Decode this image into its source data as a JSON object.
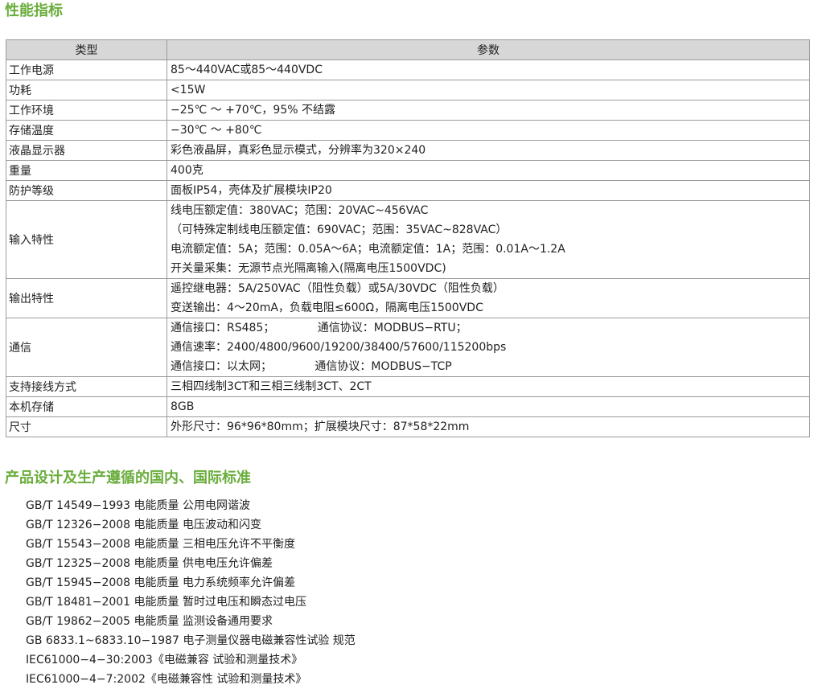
{
  "section1_title": "性能指标",
  "table": {
    "headers": [
      "类型",
      "参数"
    ],
    "rows": [
      {
        "type": "工作电源",
        "lines": [
          "85～440VAC或85～440VDC"
        ]
      },
      {
        "type": "功耗",
        "lines": [
          "<15W"
        ]
      },
      {
        "type": "工作环境",
        "lines": [
          "−25℃ ～ +70℃，95% 不结露"
        ]
      },
      {
        "type": "存储温度",
        "lines": [
          "−30℃ ～ +80℃"
        ]
      },
      {
        "type": "液晶显示器",
        "lines": [
          "彩色液晶屏，真彩色显示模式，分辨率为320×240"
        ]
      },
      {
        "type": "重量",
        "lines": [
          "400克"
        ]
      },
      {
        "type": "防护等级",
        "lines": [
          "面板IP54，壳体及扩展模块IP20"
        ]
      },
      {
        "type": "输入特性",
        "lines": [
          "线电压额定值：380VAC；范围：20VAC~456VAC",
          "（可特殊定制线电压额定值：690VAC；范围：35VAC~828VAC）",
          "电流额定值：5A；范围：0.05A～6A；电流额定值：1A；范围：0.01A～1.2A",
          "开关量采集：无源节点光隔离输入(隔离电压1500VDC)"
        ]
      },
      {
        "type": "输出特性",
        "lines": [
          "遥控继电器：5A/250VAC（阻性负载）或5A/30VDC（阻性负载）",
          "变送输出：4～20mA，负载电阻≤600Ω，隔离电压1500VDC"
        ]
      },
      {
        "type": "通信",
        "lines": [
          "通信接口：RS485；            通信协议：MODBUS−RTU；",
          "通信速率：2400/4800/9600/19200/38400/57600/115200bps",
          "通信接口：以太网；            通信协议：MODBUS−TCP"
        ]
      },
      {
        "type": "支持接线方式",
        "lines": [
          "三相四线制3CT和三相三线制3CT、2CT"
        ]
      },
      {
        "type": "本机存储",
        "lines": [
          "8GB"
        ]
      },
      {
        "type": "尺寸",
        "lines": [
          "外形尺寸：96*96*80mm；扩展模块尺寸：87*58*22mm"
        ]
      }
    ]
  },
  "section2_title": "产品设计及生产遵循的国内、国际标准",
  "standards": [
    "GB/T 14549−1993 电能质量 公用电网谐波",
    "GB/T 12326−2008 电能质量 电压波动和闪变",
    "GB/T 15543−2008 电能质量 三相电压允许不平衡度",
    "GB/T 12325−2008 电能质量 供电电压允许偏差",
    "GB/T 15945−2008 电能质量 电力系统频率允许偏差",
    "GB/T 18481−2001 电能质量 暂时过电压和瞬态过电压",
    "GB/T 19862−2005 电能质量 监测设备通用要求",
    "GB 6833.1~6833.10−1987 电子测量仪器电磁兼容性试验 规范",
    "IEC61000−4−30:2003《电磁兼容 试验和测量技术》",
    "IEC61000−4−7:2002《电磁兼容性 试验和测量技术》"
  ],
  "colors": {
    "accent": "#6aad3c",
    "header_bg": "#d7d7d7",
    "border": "#9a9a9a"
  }
}
